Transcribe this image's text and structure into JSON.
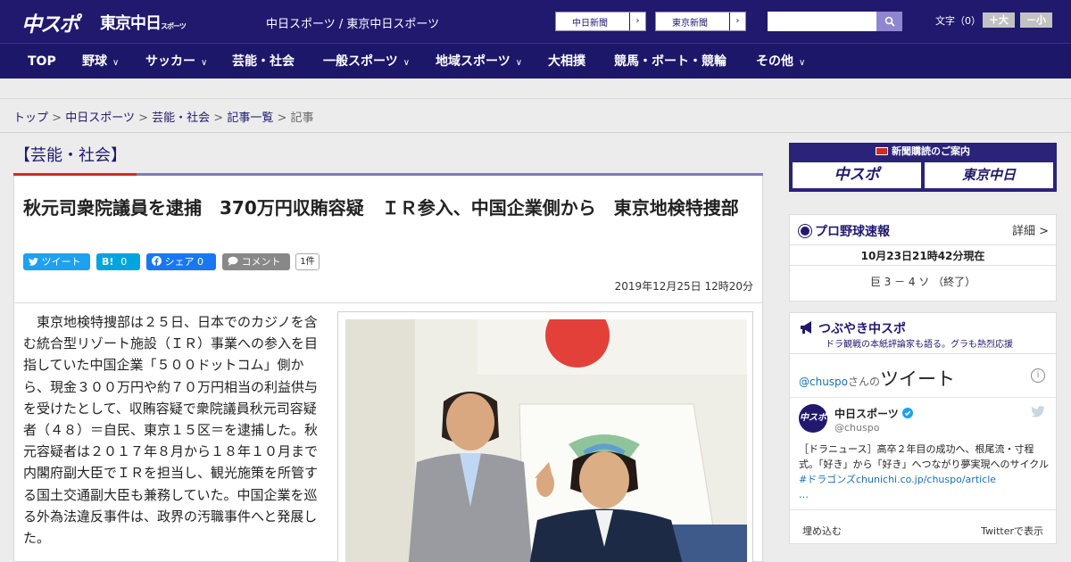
{
  "header": {
    "logo_chuspo": "中スポ",
    "logo_tokyo": "東京中日",
    "logo_tokyo_small": "スポーツ",
    "site_title": "中日スポーツ / 東京中日スポーツ",
    "link_chunichi": "中日新聞",
    "link_tokyo": "東京新聞",
    "link_arrow": "›",
    "search_placeholder": "",
    "font_label": "文字（0）",
    "font_plus": "＋大",
    "font_minus": "－小"
  },
  "nav": {
    "items": [
      {
        "label": "TOP",
        "chevron": false
      },
      {
        "label": "野球",
        "chevron": true
      },
      {
        "label": "サッカー",
        "chevron": true
      },
      {
        "label": "芸能・社会",
        "chevron": false
      },
      {
        "label": "一般スポーツ",
        "chevron": true
      },
      {
        "label": "地域スポーツ",
        "chevron": true
      },
      {
        "label": "大相撲",
        "chevron": false
      },
      {
        "label": "競馬・ボート・競輪",
        "chevron": false
      },
      {
        "label": "その他",
        "chevron": true
      }
    ]
  },
  "breadcrumb": {
    "items": [
      "トップ",
      "中日スポーツ",
      "芸能・社会",
      "記事一覧"
    ],
    "current": "記事",
    "sep": ">"
  },
  "category": "【芸能・社会】",
  "article": {
    "headline": "秋元司衆院議員を逮捕　370万円収賄容疑　ＩＲ参入、中国企業側から　東京地検特捜部",
    "share": {
      "tweet": "ツイート",
      "hatena": "B!",
      "hatena_count": "0",
      "facebook": "シェア",
      "facebook_count": "0",
      "comment": "コメント",
      "comment_count": "1件"
    },
    "date": "2019年12月25日 12時20分",
    "body": "東京地検特捜部は２５日、日本でのカジノを含む統合型リゾート施設（ＩＲ）事業への参入を目指していた中国企業「５００ドットコム」側から、現金３００万円や約７０万円相当の利益供与を受けたとして、収賄容疑で衆院議員秋元司容疑者（４８）＝自民、東京１５区＝を逮捕した。秋元容疑者は２０１７年８月から１８年１０月まで内閣府副大臣でＩＲを担当し、観光施策を所管する国土交通副大臣も兼務していた。中国企業を巡る外為法違反事件は、政界の汚職事件へと発展した。"
  },
  "sidebar": {
    "subscription": {
      "label": "新聞購読のご案内",
      "paper1": "中スポ",
      "paper2": "東京中日"
    },
    "baseball": {
      "title": "プロ野球速報",
      "more": "詳細 >",
      "time": "10月23日21時42分現在",
      "score": "巨 3 － 4 ソ （終了）"
    },
    "tweets": {
      "title": "つぶやき中スポ",
      "subtitle": "ドラ観戦の本紙評論家も語る。グラも熱烈応援",
      "head_user": "@chuspo",
      "head_san": "さんの",
      "head_big": "ツイート",
      "info": "i",
      "avatar_text": "中スポ",
      "name": "中日スポーツ",
      "handle": "@chuspo",
      "text": "［ドラニュース］高卒２年目の成功へ、根尾流・寸程式。「好き」から「好き」へつながり夢実現へのサイクル",
      "text_link": "#ドラゴンズchunichi.co.jp/chuspo/article",
      "text_more": "…",
      "embed": "埋め込む",
      "view": "Twitterで表示"
    }
  },
  "colors": {
    "brand_navy": "#20196e",
    "accent_red": "#d42b1e",
    "twitter_blue": "#1da1f2",
    "facebook_blue": "#1877f2"
  }
}
